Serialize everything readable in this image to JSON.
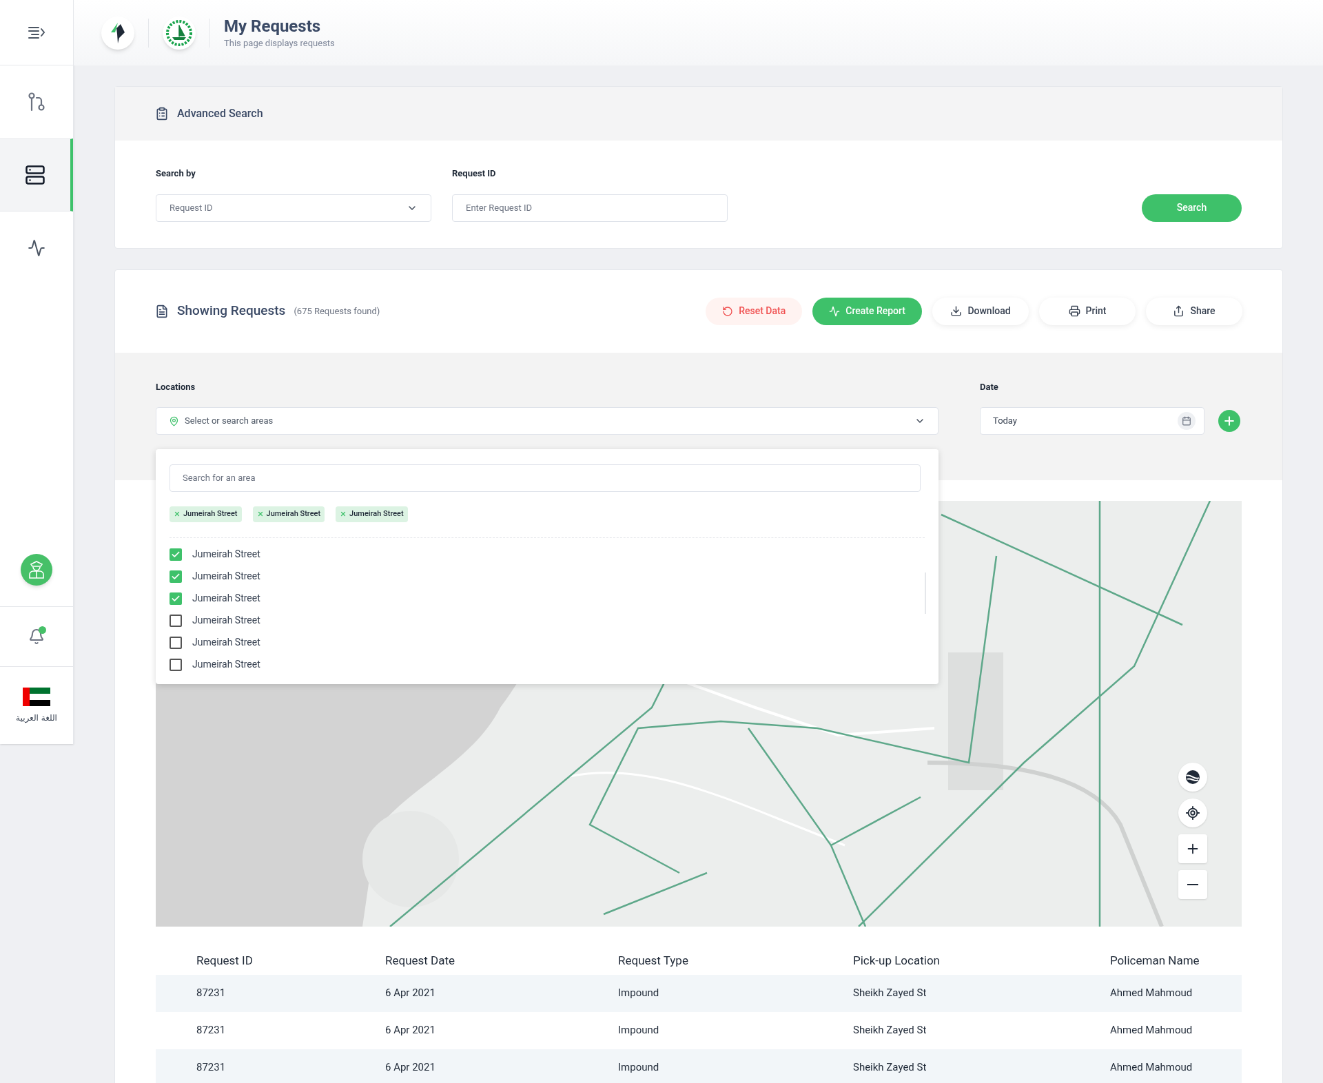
{
  "header": {
    "title": "My Requests",
    "subtitle": "This page displays requests"
  },
  "sidebar": {
    "items": [
      {
        "selected": false
      },
      {
        "selected": true
      },
      {
        "selected": false
      }
    ],
    "notifications": {
      "unread": true
    },
    "language": "اللغة العربية"
  },
  "advanced_search": {
    "title": "Advanced Search",
    "search_by": {
      "label": "Search by",
      "value": "Request ID"
    },
    "request_id": {
      "label": "Request ID",
      "placeholder": "Enter Request ID"
    },
    "button": "Search"
  },
  "requests": {
    "title": "Showing Requests",
    "count": "(675 Requests found)",
    "actions": [
      {
        "label": "Reset Data",
        "kind": "danger"
      },
      {
        "label": "Create Report",
        "kind": "primary"
      },
      {
        "label": "Download",
        "kind": "download"
      },
      {
        "label": "Print",
        "kind": "print"
      },
      {
        "label": "Share",
        "kind": "share"
      }
    ],
    "locations": {
      "label": "Locations",
      "placeholder": "Select or search areas"
    },
    "dropdown": {
      "search_placeholder": "Search for an area",
      "chips": [
        "Jumeirah Street",
        "Jumeirah Street",
        "Jumeirah Street"
      ],
      "options": [
        {
          "label": "Jumeirah Street",
          "checked": true
        },
        {
          "label": "Jumeirah Street",
          "checked": true
        },
        {
          "label": "Jumeirah Street",
          "checked": true
        },
        {
          "label": "Jumeirah Street",
          "checked": false
        },
        {
          "label": "Jumeirah Street",
          "checked": false
        },
        {
          "label": "Jumeirah Street",
          "checked": false
        }
      ]
    },
    "date": {
      "label": "Date",
      "value": "Today"
    },
    "table": {
      "columns": [
        "Request ID",
        "Request Date",
        "Request Type",
        "Pick-up Location",
        "Policeman Name"
      ],
      "rows": [
        [
          "87231",
          "6 Apr 2021",
          "Impound",
          "Sheikh Zayed St",
          "Ahmed Mahmoud"
        ],
        [
          "87231",
          "6 Apr 2021",
          "Impound",
          "Sheikh Zayed St",
          "Ahmed Mahmoud"
        ],
        [
          "87231",
          "6 Apr 2021",
          "Impound",
          "Sheikh Zayed St",
          "Ahmed Mahmoud"
        ]
      ]
    }
  }
}
